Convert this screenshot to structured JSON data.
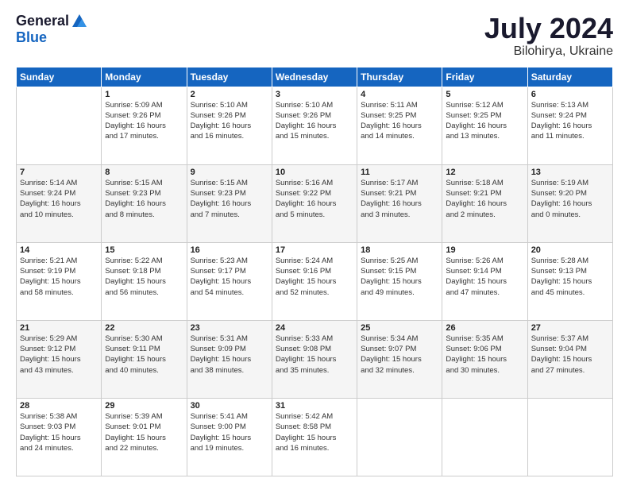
{
  "logo": {
    "general": "General",
    "blue": "Blue"
  },
  "title": {
    "month_year": "July 2024",
    "location": "Bilohirya, Ukraine"
  },
  "weekdays": [
    "Sunday",
    "Monday",
    "Tuesday",
    "Wednesday",
    "Thursday",
    "Friday",
    "Saturday"
  ],
  "weeks": [
    [
      {
        "day": "",
        "detail": ""
      },
      {
        "day": "1",
        "detail": "Sunrise: 5:09 AM\nSunset: 9:26 PM\nDaylight: 16 hours\nand 17 minutes."
      },
      {
        "day": "2",
        "detail": "Sunrise: 5:10 AM\nSunset: 9:26 PM\nDaylight: 16 hours\nand 16 minutes."
      },
      {
        "day": "3",
        "detail": "Sunrise: 5:10 AM\nSunset: 9:26 PM\nDaylight: 16 hours\nand 15 minutes."
      },
      {
        "day": "4",
        "detail": "Sunrise: 5:11 AM\nSunset: 9:25 PM\nDaylight: 16 hours\nand 14 minutes."
      },
      {
        "day": "5",
        "detail": "Sunrise: 5:12 AM\nSunset: 9:25 PM\nDaylight: 16 hours\nand 13 minutes."
      },
      {
        "day": "6",
        "detail": "Sunrise: 5:13 AM\nSunset: 9:24 PM\nDaylight: 16 hours\nand 11 minutes."
      }
    ],
    [
      {
        "day": "7",
        "detail": "Sunrise: 5:14 AM\nSunset: 9:24 PM\nDaylight: 16 hours\nand 10 minutes."
      },
      {
        "day": "8",
        "detail": "Sunrise: 5:15 AM\nSunset: 9:23 PM\nDaylight: 16 hours\nand 8 minutes."
      },
      {
        "day": "9",
        "detail": "Sunrise: 5:15 AM\nSunset: 9:23 PM\nDaylight: 16 hours\nand 7 minutes."
      },
      {
        "day": "10",
        "detail": "Sunrise: 5:16 AM\nSunset: 9:22 PM\nDaylight: 16 hours\nand 5 minutes."
      },
      {
        "day": "11",
        "detail": "Sunrise: 5:17 AM\nSunset: 9:21 PM\nDaylight: 16 hours\nand 3 minutes."
      },
      {
        "day": "12",
        "detail": "Sunrise: 5:18 AM\nSunset: 9:21 PM\nDaylight: 16 hours\nand 2 minutes."
      },
      {
        "day": "13",
        "detail": "Sunrise: 5:19 AM\nSunset: 9:20 PM\nDaylight: 16 hours\nand 0 minutes."
      }
    ],
    [
      {
        "day": "14",
        "detail": "Sunrise: 5:21 AM\nSunset: 9:19 PM\nDaylight: 15 hours\nand 58 minutes."
      },
      {
        "day": "15",
        "detail": "Sunrise: 5:22 AM\nSunset: 9:18 PM\nDaylight: 15 hours\nand 56 minutes."
      },
      {
        "day": "16",
        "detail": "Sunrise: 5:23 AM\nSunset: 9:17 PM\nDaylight: 15 hours\nand 54 minutes."
      },
      {
        "day": "17",
        "detail": "Sunrise: 5:24 AM\nSunset: 9:16 PM\nDaylight: 15 hours\nand 52 minutes."
      },
      {
        "day": "18",
        "detail": "Sunrise: 5:25 AM\nSunset: 9:15 PM\nDaylight: 15 hours\nand 49 minutes."
      },
      {
        "day": "19",
        "detail": "Sunrise: 5:26 AM\nSunset: 9:14 PM\nDaylight: 15 hours\nand 47 minutes."
      },
      {
        "day": "20",
        "detail": "Sunrise: 5:28 AM\nSunset: 9:13 PM\nDaylight: 15 hours\nand 45 minutes."
      }
    ],
    [
      {
        "day": "21",
        "detail": "Sunrise: 5:29 AM\nSunset: 9:12 PM\nDaylight: 15 hours\nand 43 minutes."
      },
      {
        "day": "22",
        "detail": "Sunrise: 5:30 AM\nSunset: 9:11 PM\nDaylight: 15 hours\nand 40 minutes."
      },
      {
        "day": "23",
        "detail": "Sunrise: 5:31 AM\nSunset: 9:09 PM\nDaylight: 15 hours\nand 38 minutes."
      },
      {
        "day": "24",
        "detail": "Sunrise: 5:33 AM\nSunset: 9:08 PM\nDaylight: 15 hours\nand 35 minutes."
      },
      {
        "day": "25",
        "detail": "Sunrise: 5:34 AM\nSunset: 9:07 PM\nDaylight: 15 hours\nand 32 minutes."
      },
      {
        "day": "26",
        "detail": "Sunrise: 5:35 AM\nSunset: 9:06 PM\nDaylight: 15 hours\nand 30 minutes."
      },
      {
        "day": "27",
        "detail": "Sunrise: 5:37 AM\nSunset: 9:04 PM\nDaylight: 15 hours\nand 27 minutes."
      }
    ],
    [
      {
        "day": "28",
        "detail": "Sunrise: 5:38 AM\nSunset: 9:03 PM\nDaylight: 15 hours\nand 24 minutes."
      },
      {
        "day": "29",
        "detail": "Sunrise: 5:39 AM\nSunset: 9:01 PM\nDaylight: 15 hours\nand 22 minutes."
      },
      {
        "day": "30",
        "detail": "Sunrise: 5:41 AM\nSunset: 9:00 PM\nDaylight: 15 hours\nand 19 minutes."
      },
      {
        "day": "31",
        "detail": "Sunrise: 5:42 AM\nSunset: 8:58 PM\nDaylight: 15 hours\nand 16 minutes."
      },
      {
        "day": "",
        "detail": ""
      },
      {
        "day": "",
        "detail": ""
      },
      {
        "day": "",
        "detail": ""
      }
    ]
  ]
}
